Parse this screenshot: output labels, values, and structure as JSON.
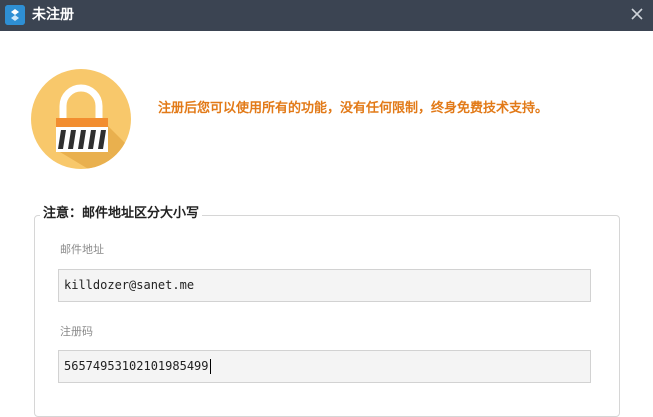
{
  "window": {
    "title": "未注册",
    "icon": "app-logo-icon",
    "close_icon": "close-icon",
    "titlebar_color": "#3b4452"
  },
  "notice": {
    "icon": "lock-icon",
    "text": "注册后您可以使用所有的功能，没有任何限制，终身免费技术支持。",
    "color": "#e27a18"
  },
  "form": {
    "legend": "注意：邮件地址区分大小写",
    "email": {
      "label": "邮件地址",
      "value": "killdozer@sanet.me"
    },
    "code": {
      "label": "注册码",
      "value": "56574953102101985499"
    }
  }
}
